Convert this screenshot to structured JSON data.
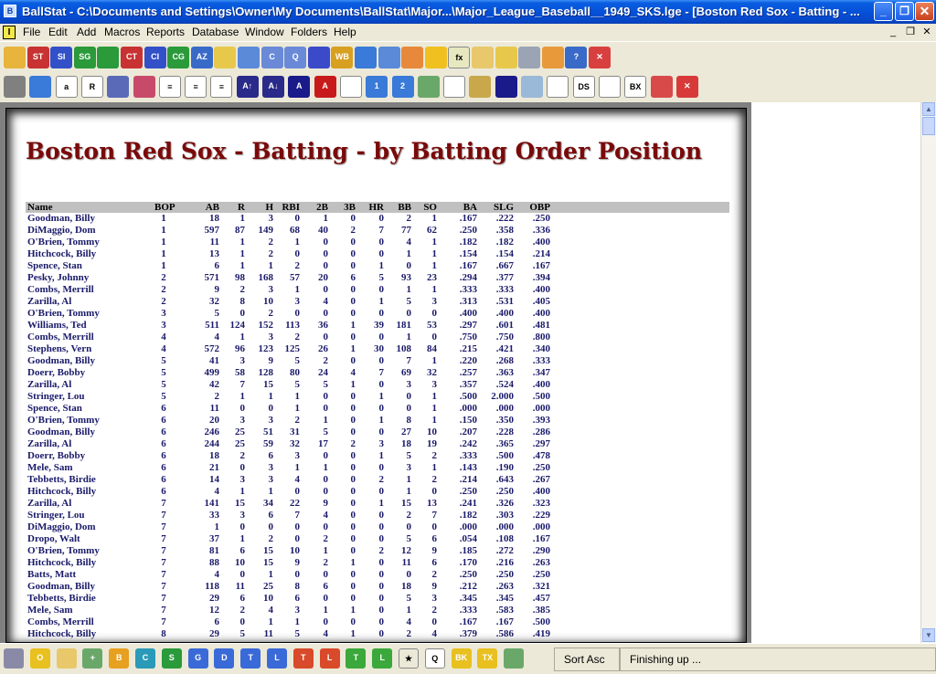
{
  "window": {
    "title": "BallStat - C:\\Documents and Settings\\Owner\\My Documents\\BallStat\\Major...\\Major_League_Baseball__1949_SKS.lge - [Boston Red Sox - Batting - ...",
    "app_icon_label": "B",
    "minimize_label": "_",
    "maximize_label": "❐",
    "close_label": "✕"
  },
  "menu": {
    "mdi_icon_label": "I",
    "items": [
      "File",
      "Edit",
      "Add",
      "Macros",
      "Reports",
      "Database",
      "Window",
      "Folders",
      "Help"
    ],
    "mdi_minimize": "_",
    "mdi_restore": "❐",
    "mdi_close": "✕"
  },
  "toolbar1": [
    {
      "name": "open-folder-icon",
      "label": "",
      "color": "#e8b43c"
    },
    {
      "name": "st-icon",
      "label": "ST",
      "color": "#c83232"
    },
    {
      "name": "si-icon",
      "label": "SI",
      "color": "#3250c8"
    },
    {
      "name": "sg-icon",
      "label": "SG",
      "color": "#2a9a3a"
    },
    {
      "name": "green-doc-icon",
      "label": "",
      "color": "#2a9a3a"
    },
    {
      "name": "ct-icon",
      "label": "CT",
      "color": "#c83232"
    },
    {
      "name": "ci-icon",
      "label": "CI",
      "color": "#3250c8"
    },
    {
      "name": "cg-icon",
      "label": "CG",
      "color": "#2a9a3a"
    },
    {
      "name": "sort-az-icon",
      "label": "AZ",
      "color": "#3a6ac8"
    },
    {
      "name": "ruler-icon",
      "label": "",
      "color": "#e8c84a"
    },
    {
      "name": "folder-blue-icon",
      "label": "",
      "color": "#5a8ad8"
    },
    {
      "name": "c-window-icon",
      "label": "C",
      "color": "#6a8ad8"
    },
    {
      "name": "q-window-icon",
      "label": "Q",
      "color": "#6a8ad8"
    },
    {
      "name": "gear-icon",
      "label": "",
      "color": "#3a4ac8"
    },
    {
      "name": "wb-icon",
      "label": "WB",
      "color": "#d8a020"
    },
    {
      "name": "globe-icon",
      "label": "",
      "color": "#3a7ad8"
    },
    {
      "name": "export-icon",
      "label": "",
      "color": "#5a8ad8"
    },
    {
      "name": "expand-icon",
      "label": "",
      "color": "#e8883a"
    },
    {
      "name": "star-icon",
      "label": "",
      "color": "#f0c020"
    },
    {
      "name": "fx-icon",
      "label": "fx",
      "color": "#e8e8c0"
    },
    {
      "name": "clipboard-icon",
      "label": "",
      "color": "#e8c86a"
    },
    {
      "name": "folder-icon",
      "label": "",
      "color": "#e8c84a"
    },
    {
      "name": "grid-icon",
      "label": "",
      "color": "#9aa4b4"
    },
    {
      "name": "pencil-icon",
      "label": "",
      "color": "#e89a3a"
    },
    {
      "name": "help-icon",
      "label": "?",
      "color": "#3a6ac8"
    },
    {
      "name": "delete-x-icon",
      "label": "✕",
      "color": "#d84040"
    }
  ],
  "toolbar2": [
    {
      "name": "print-icon",
      "label": "",
      "color": "#808080"
    },
    {
      "name": "web-icon",
      "label": "",
      "color": "#3a7ad8"
    },
    {
      "name": "font-a-icon",
      "label": "a",
      "color": "#ffffff"
    },
    {
      "name": "font-r-icon",
      "label": "R",
      "color": "#ffffff"
    },
    {
      "name": "save-icon",
      "label": "",
      "color": "#5a6ab8"
    },
    {
      "name": "save-all-icon",
      "label": "",
      "color": "#c84a6a"
    },
    {
      "name": "align-left-icon",
      "label": "≡",
      "color": "#ffffff"
    },
    {
      "name": "align-center-icon",
      "label": "≡",
      "color": "#ffffff"
    },
    {
      "name": "align-right-icon",
      "label": "≡",
      "color": "#ffffff"
    },
    {
      "name": "font-grow-icon",
      "label": "A↑",
      "color": "#2a2a8a"
    },
    {
      "name": "font-shrink-icon",
      "label": "A↓",
      "color": "#2a2a8a"
    },
    {
      "name": "bold-a-icon",
      "label": "A",
      "color": "#1a1a8a"
    },
    {
      "name": "red-a-icon",
      "label": "A",
      "color": "#c81a1a"
    },
    {
      "name": "page-icon",
      "label": "",
      "color": "#ffffff"
    },
    {
      "name": "balloon-1-icon",
      "label": "1",
      "color": "#3a7ad8"
    },
    {
      "name": "balloon-2-icon",
      "label": "2",
      "color": "#3a7ad8"
    },
    {
      "name": "picture-icon",
      "label": "",
      "color": "#6aa86a"
    },
    {
      "name": "document-icon",
      "label": "",
      "color": "#ffffff"
    },
    {
      "name": "tools-icon",
      "label": "",
      "color": "#c8a84a"
    },
    {
      "name": "ball-icon",
      "label": "",
      "color": "#1a1a8a"
    },
    {
      "name": "magnifier-icon",
      "label": "",
      "color": "#9ab8d8"
    },
    {
      "name": "bar-doc-icon",
      "label": "",
      "color": "#ffffff"
    },
    {
      "name": "ds-icon",
      "label": "DS",
      "color": "#ffffff"
    },
    {
      "name": "columns-icon",
      "label": "",
      "color": "#ffffff"
    },
    {
      "name": "bx-icon",
      "label": "BX",
      "color": "#ffffff"
    },
    {
      "name": "red-folder-icon",
      "label": "",
      "color": "#d84a4a"
    },
    {
      "name": "stop-icon",
      "label": "✕",
      "color": "#d83a3a"
    }
  ],
  "report": {
    "title": "Boston Red Sox - Batting - by Batting Order Position",
    "columns": [
      "Name",
      "BOP",
      "AB",
      "R",
      "H",
      "RBI",
      "2B",
      "3B",
      "HR",
      "BB",
      "SO",
      "BA",
      "SLG",
      "OBP"
    ],
    "rows": [
      [
        "Goodman, Billy",
        "1",
        "18",
        "1",
        "3",
        "0",
        "1",
        "0",
        "0",
        "2",
        "1",
        ".167",
        ".222",
        ".250"
      ],
      [
        "DiMaggio, Dom",
        "1",
        "597",
        "87",
        "149",
        "68",
        "40",
        "2",
        "7",
        "77",
        "62",
        ".250",
        ".358",
        ".336"
      ],
      [
        "O'Brien, Tommy",
        "1",
        "11",
        "1",
        "2",
        "1",
        "0",
        "0",
        "0",
        "4",
        "1",
        ".182",
        ".182",
        ".400"
      ],
      [
        "Hitchcock, Billy",
        "1",
        "13",
        "1",
        "2",
        "0",
        "0",
        "0",
        "0",
        "1",
        "1",
        ".154",
        ".154",
        ".214"
      ],
      [
        "Spence, Stan",
        "1",
        "6",
        "1",
        "1",
        "2",
        "0",
        "0",
        "1",
        "0",
        "1",
        ".167",
        ".667",
        ".167"
      ],
      [
        "Pesky, Johnny",
        "2",
        "571",
        "98",
        "168",
        "57",
        "20",
        "6",
        "5",
        "93",
        "23",
        ".294",
        ".377",
        ".394"
      ],
      [
        "Combs, Merrill",
        "2",
        "9",
        "2",
        "3",
        "1",
        "0",
        "0",
        "0",
        "1",
        "1",
        ".333",
        ".333",
        ".400"
      ],
      [
        "Zarilla, Al",
        "2",
        "32",
        "8",
        "10",
        "3",
        "4",
        "0",
        "1",
        "5",
        "3",
        ".313",
        ".531",
        ".405"
      ],
      [
        "O'Brien, Tommy",
        "3",
        "5",
        "0",
        "2",
        "0",
        "0",
        "0",
        "0",
        "0",
        "0",
        ".400",
        ".400",
        ".400"
      ],
      [
        "Williams, Ted",
        "3",
        "511",
        "124",
        "152",
        "113",
        "36",
        "1",
        "39",
        "181",
        "53",
        ".297",
        ".601",
        ".481"
      ],
      [
        "Combs, Merrill",
        "4",
        "4",
        "1",
        "3",
        "2",
        "0",
        "0",
        "0",
        "1",
        "0",
        ".750",
        ".750",
        ".800"
      ],
      [
        "Stephens, Vern",
        "4",
        "572",
        "96",
        "123",
        "125",
        "26",
        "1",
        "30",
        "108",
        "84",
        ".215",
        ".421",
        ".340"
      ],
      [
        "Goodman, Billy",
        "5",
        "41",
        "3",
        "9",
        "5",
        "2",
        "0",
        "0",
        "7",
        "1",
        ".220",
        ".268",
        ".333"
      ],
      [
        "Doerr, Bobby",
        "5",
        "499",
        "58",
        "128",
        "80",
        "24",
        "4",
        "7",
        "69",
        "32",
        ".257",
        ".363",
        ".347"
      ],
      [
        "Zarilla, Al",
        "5",
        "42",
        "7",
        "15",
        "5",
        "5",
        "1",
        "0",
        "3",
        "3",
        ".357",
        ".524",
        ".400"
      ],
      [
        "Stringer, Lou",
        "5",
        "2",
        "1",
        "1",
        "1",
        "0",
        "0",
        "1",
        "0",
        "1",
        ".500",
        "2.000",
        ".500"
      ],
      [
        "Spence, Stan",
        "6",
        "11",
        "0",
        "0",
        "1",
        "0",
        "0",
        "0",
        "0",
        "1",
        ".000",
        ".000",
        ".000"
      ],
      [
        "O'Brien, Tommy",
        "6",
        "20",
        "3",
        "3",
        "2",
        "1",
        "0",
        "1",
        "8",
        "1",
        ".150",
        ".350",
        ".393"
      ],
      [
        "Goodman, Billy",
        "6",
        "246",
        "25",
        "51",
        "31",
        "5",
        "0",
        "0",
        "27",
        "10",
        ".207",
        ".228",
        ".286"
      ],
      [
        "Zarilla, Al",
        "6",
        "244",
        "25",
        "59",
        "32",
        "17",
        "2",
        "3",
        "18",
        "19",
        ".242",
        ".365",
        ".297"
      ],
      [
        "Doerr, Bobby",
        "6",
        "18",
        "2",
        "6",
        "3",
        "0",
        "0",
        "1",
        "5",
        "2",
        ".333",
        ".500",
        ".478"
      ],
      [
        "Mele, Sam",
        "6",
        "21",
        "0",
        "3",
        "1",
        "1",
        "0",
        "0",
        "3",
        "1",
        ".143",
        ".190",
        ".250"
      ],
      [
        "Tebbetts, Birdie",
        "6",
        "14",
        "3",
        "3",
        "4",
        "0",
        "0",
        "2",
        "1",
        "2",
        ".214",
        ".643",
        ".267"
      ],
      [
        "Hitchcock, Billy",
        "6",
        "4",
        "1",
        "1",
        "0",
        "0",
        "0",
        "0",
        "1",
        "0",
        ".250",
        ".250",
        ".400"
      ],
      [
        "Zarilla, Al",
        "7",
        "141",
        "15",
        "34",
        "22",
        "9",
        "0",
        "1",
        "15",
        "13",
        ".241",
        ".326",
        ".323"
      ],
      [
        "Stringer, Lou",
        "7",
        "33",
        "3",
        "6",
        "7",
        "4",
        "0",
        "0",
        "2",
        "7",
        ".182",
        ".303",
        ".229"
      ],
      [
        "DiMaggio, Dom",
        "7",
        "1",
        "0",
        "0",
        "0",
        "0",
        "0",
        "0",
        "0",
        "0",
        ".000",
        ".000",
        ".000"
      ],
      [
        "Dropo, Walt",
        "7",
        "37",
        "1",
        "2",
        "0",
        "2",
        "0",
        "0",
        "5",
        "6",
        ".054",
        ".108",
        ".167"
      ],
      [
        "O'Brien, Tommy",
        "7",
        "81",
        "6",
        "15",
        "10",
        "1",
        "0",
        "2",
        "12",
        "9",
        ".185",
        ".272",
        ".290"
      ],
      [
        "Hitchcock, Billy",
        "7",
        "88",
        "10",
        "15",
        "9",
        "2",
        "1",
        "0",
        "11",
        "6",
        ".170",
        ".216",
        ".263"
      ],
      [
        "Batts, Matt",
        "7",
        "4",
        "0",
        "1",
        "0",
        "0",
        "0",
        "0",
        "0",
        "2",
        ".250",
        ".250",
        ".250"
      ],
      [
        "Goodman, Billy",
        "7",
        "118",
        "11",
        "25",
        "8",
        "6",
        "0",
        "0",
        "18",
        "9",
        ".212",
        ".263",
        ".321"
      ],
      [
        "Tebbetts, Birdie",
        "7",
        "29",
        "6",
        "10",
        "6",
        "0",
        "0",
        "0",
        "5",
        "3",
        ".345",
        ".345",
        ".457"
      ],
      [
        "Mele, Sam",
        "7",
        "12",
        "2",
        "4",
        "3",
        "1",
        "1",
        "0",
        "1",
        "2",
        ".333",
        ".583",
        ".385"
      ],
      [
        "Combs, Merrill",
        "7",
        "6",
        "0",
        "1",
        "1",
        "0",
        "0",
        "0",
        "4",
        "0",
        ".167",
        ".167",
        ".500"
      ],
      [
        "Hitchcock, Billy",
        "8",
        "29",
        "5",
        "11",
        "5",
        "4",
        "1",
        "0",
        "2",
        "4",
        ".379",
        ".586",
        ".419"
      ]
    ]
  },
  "statusbar": {
    "buttons": [
      {
        "name": "edit-pencil-icon",
        "label": "",
        "color": "#8a8aa8"
      },
      {
        "name": "o-icon",
        "label": "O",
        "color": "#e8c020"
      },
      {
        "name": "notepad-icon",
        "label": "",
        "color": "#e8c86a"
      },
      {
        "name": "add-doc-icon",
        "label": "+",
        "color": "#6aa86a"
      },
      {
        "name": "b-icon",
        "label": "B",
        "color": "#e8a020"
      },
      {
        "name": "c-icon",
        "label": "C",
        "color": "#2a9ab8"
      },
      {
        "name": "s-icon",
        "label": "S",
        "color": "#2a9a3a"
      },
      {
        "name": "g-icon",
        "label": "G",
        "color": "#3a6ad8"
      },
      {
        "name": "d-icon",
        "label": "D",
        "color": "#3a6ad8"
      },
      {
        "name": "t-blue-icon",
        "label": "T",
        "color": "#3a6ad8"
      },
      {
        "name": "l-blue-icon",
        "label": "L",
        "color": "#3a6ad8"
      },
      {
        "name": "t-red-icon",
        "label": "T",
        "color": "#d84a2a"
      },
      {
        "name": "l-red-icon",
        "label": "L",
        "color": "#d84a2a"
      },
      {
        "name": "t-green-icon",
        "label": "T",
        "color": "#3aa83a"
      },
      {
        "name": "l-green-icon",
        "label": "L",
        "color": "#3aa83a"
      },
      {
        "name": "star-red-icon",
        "label": "★",
        "color": "#ece9d8"
      },
      {
        "name": "q-icon",
        "label": "Q",
        "color": "#ffffff"
      },
      {
        "name": "bk-icon",
        "label": "BK",
        "color": "#e8c020"
      },
      {
        "name": "tx-icon",
        "label": "TX",
        "color": "#e8c020"
      },
      {
        "name": "image-icon",
        "label": "",
        "color": "#6aa86a"
      }
    ],
    "sort_label": "Sort Asc",
    "status_text": "Finishing up ..."
  }
}
